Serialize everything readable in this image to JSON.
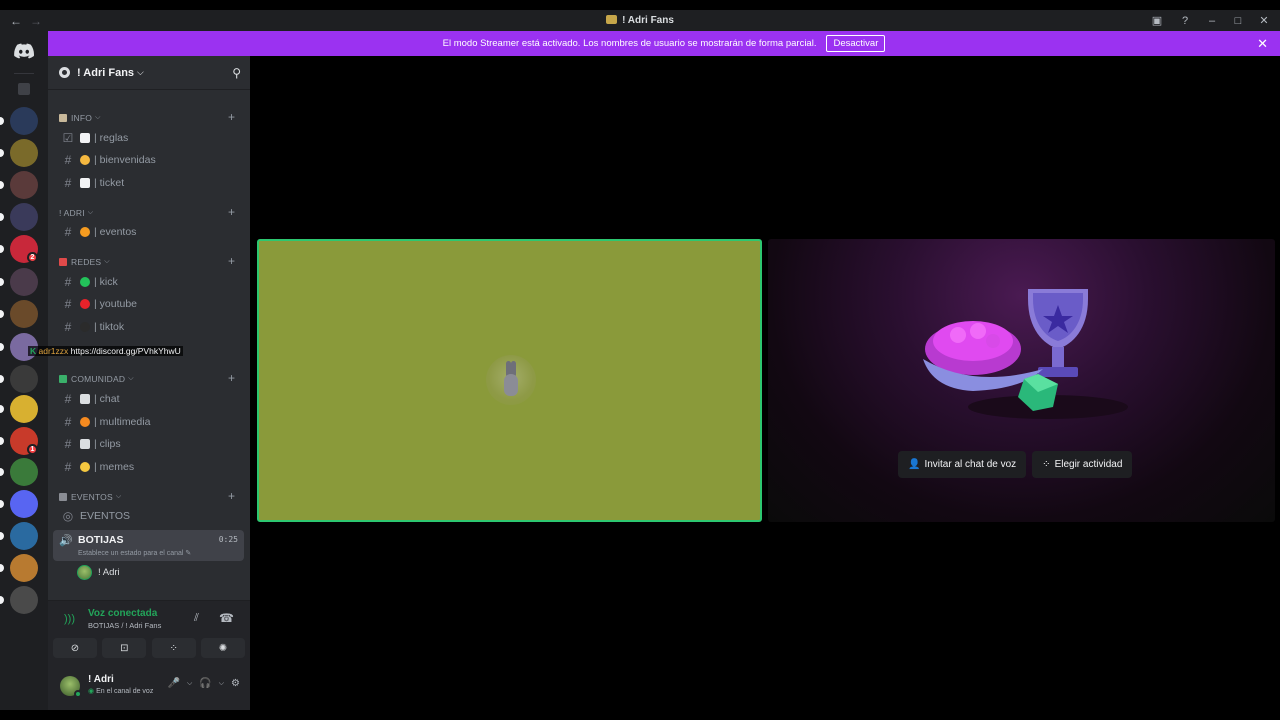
{
  "titlebar": {
    "title": "! Adri Fans",
    "back_icon": "arrow-left-icon",
    "forward_icon": "arrow-right-icon",
    "inbox_icon": "inbox-icon",
    "help_icon": "help-icon"
  },
  "banner": {
    "text": "El modo Streamer está activado. Los nombres de usuario se mostrarán de forma parcial.",
    "button": "Desactivar",
    "color": "#9b32f1"
  },
  "server": {
    "name": "! Adri Fans"
  },
  "categories": [
    {
      "label": "INFO",
      "icon_color": "#c8b89a"
    },
    {
      "label": "! ADRI",
      "icon_color": ""
    },
    {
      "label": "REDES",
      "icon_color": "#e04a4a"
    },
    {
      "label": "COMUNIDAD",
      "icon_color": "#3ab06a"
    },
    {
      "label": "EVENTOS",
      "icon_color": "#8a8d94"
    }
  ],
  "channels": [
    {
      "name": "| reglas",
      "emoji_color": "#f2f3f5"
    },
    {
      "name": "| bienvenidas",
      "emoji_color": "#f5b840"
    },
    {
      "name": "| ticket",
      "emoji_color": "#f2f3f5"
    },
    {
      "name": "| eventos",
      "emoji_color": "#f59b20"
    },
    {
      "name": "| kick",
      "emoji_color": "#23c35a"
    },
    {
      "name": "| youtube",
      "emoji_color": "#e8222a"
    },
    {
      "name": "| tiktok",
      "emoji_color": "#2b2b2b"
    },
    {
      "name": "| chat",
      "emoji_color": "#dbdee1"
    },
    {
      "name": "| multimedia",
      "emoji_color": "#f58a20"
    },
    {
      "name": "| clips",
      "emoji_color": "#dbdee1"
    },
    {
      "name": "| memes",
      "emoji_color": "#f5c840"
    }
  ],
  "stage_channel": "EVENTOS",
  "voice_channel": {
    "name": "BOTIJAS",
    "timer": "0:25",
    "status": "Establece un estado para el canal"
  },
  "voice_user": "! Adri",
  "tooltip": {
    "prefix": "K",
    "user": "adr1zzx",
    "link": "https://discord.gg/PVhkYhwU"
  },
  "voice_connected": {
    "title": "Voz conectada",
    "subtitle": "BOTIJAS / ! Adri Fans"
  },
  "user": {
    "name": "! Adri",
    "status": "En el canal de voz"
  },
  "activity": {
    "invite_button": "Invitar al chat de voz",
    "activity_button": "Elegir actividad"
  },
  "rail_servers": [
    {
      "color": "#2a3a5a",
      "badge": ""
    },
    {
      "color": "#7a6a2a",
      "badge": ""
    },
    {
      "color": "#5a3a3a",
      "badge": ""
    },
    {
      "color": "#3a3a5a",
      "badge": ""
    },
    {
      "color": "#c8283a",
      "badge": "2"
    },
    {
      "color": "#4a3a4a",
      "badge": ""
    },
    {
      "color": "#6a4a2a",
      "badge": ""
    },
    {
      "color": "#7a6aa0",
      "badge": ""
    },
    {
      "color": "#3a3a3a",
      "badge": ""
    },
    {
      "color": "#d8b030",
      "badge": ""
    },
    {
      "color": "#c83a2a",
      "badge": "1"
    },
    {
      "color": "#3a7a3a",
      "badge": ""
    },
    {
      "color": "#5865f2",
      "badge": ""
    },
    {
      "color": "#2a6aa0",
      "badge": ""
    },
    {
      "color": "#b87a30",
      "badge": ""
    },
    {
      "color": "#4a4a4a",
      "badge": ""
    }
  ]
}
